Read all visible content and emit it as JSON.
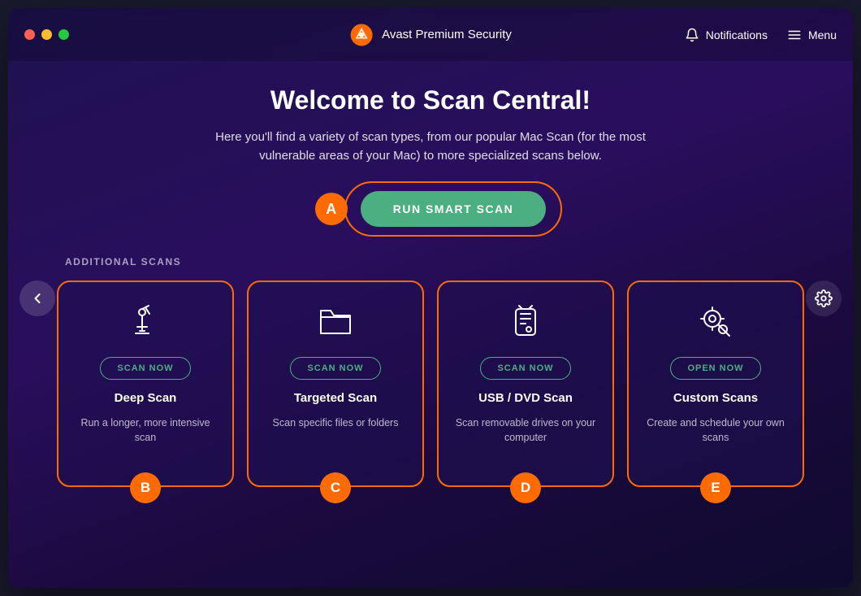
{
  "window": {
    "title": "Avast Premium Security"
  },
  "titlebar": {
    "app_name": "Avast Premium Security",
    "notifications_label": "Notifications",
    "menu_label": "Menu"
  },
  "main": {
    "page_title": "Welcome to Scan Central!",
    "page_subtitle": "Here you'll find a variety of scan types, from our popular Mac Scan (for the most vulnerable areas of your Mac) to more specialized scans below.",
    "smart_scan": {
      "badge": "A",
      "button_label": "RUN SMART SCAN"
    },
    "additional_scans_label": "ADDITIONAL SCANS",
    "scan_cards": [
      {
        "badge": "B",
        "button_label": "SCAN NOW",
        "title": "Deep Scan",
        "description": "Run a longer, more intensive scan",
        "icon": "microscope"
      },
      {
        "badge": "C",
        "button_label": "SCAN NOW",
        "title": "Targeted Scan",
        "description": "Scan specific files or folders",
        "icon": "folder"
      },
      {
        "badge": "D",
        "button_label": "SCAN NOW",
        "title": "USB / DVD Scan",
        "description": "Scan removable drives on your computer",
        "icon": "usb"
      },
      {
        "badge": "E",
        "button_label": "OPEN NOW",
        "title": "Custom Scans",
        "description": "Create and schedule your own scans",
        "icon": "gear-search"
      }
    ]
  },
  "colors": {
    "orange": "#ff6b00",
    "green": "#4caf82",
    "white": "#ffffff"
  }
}
